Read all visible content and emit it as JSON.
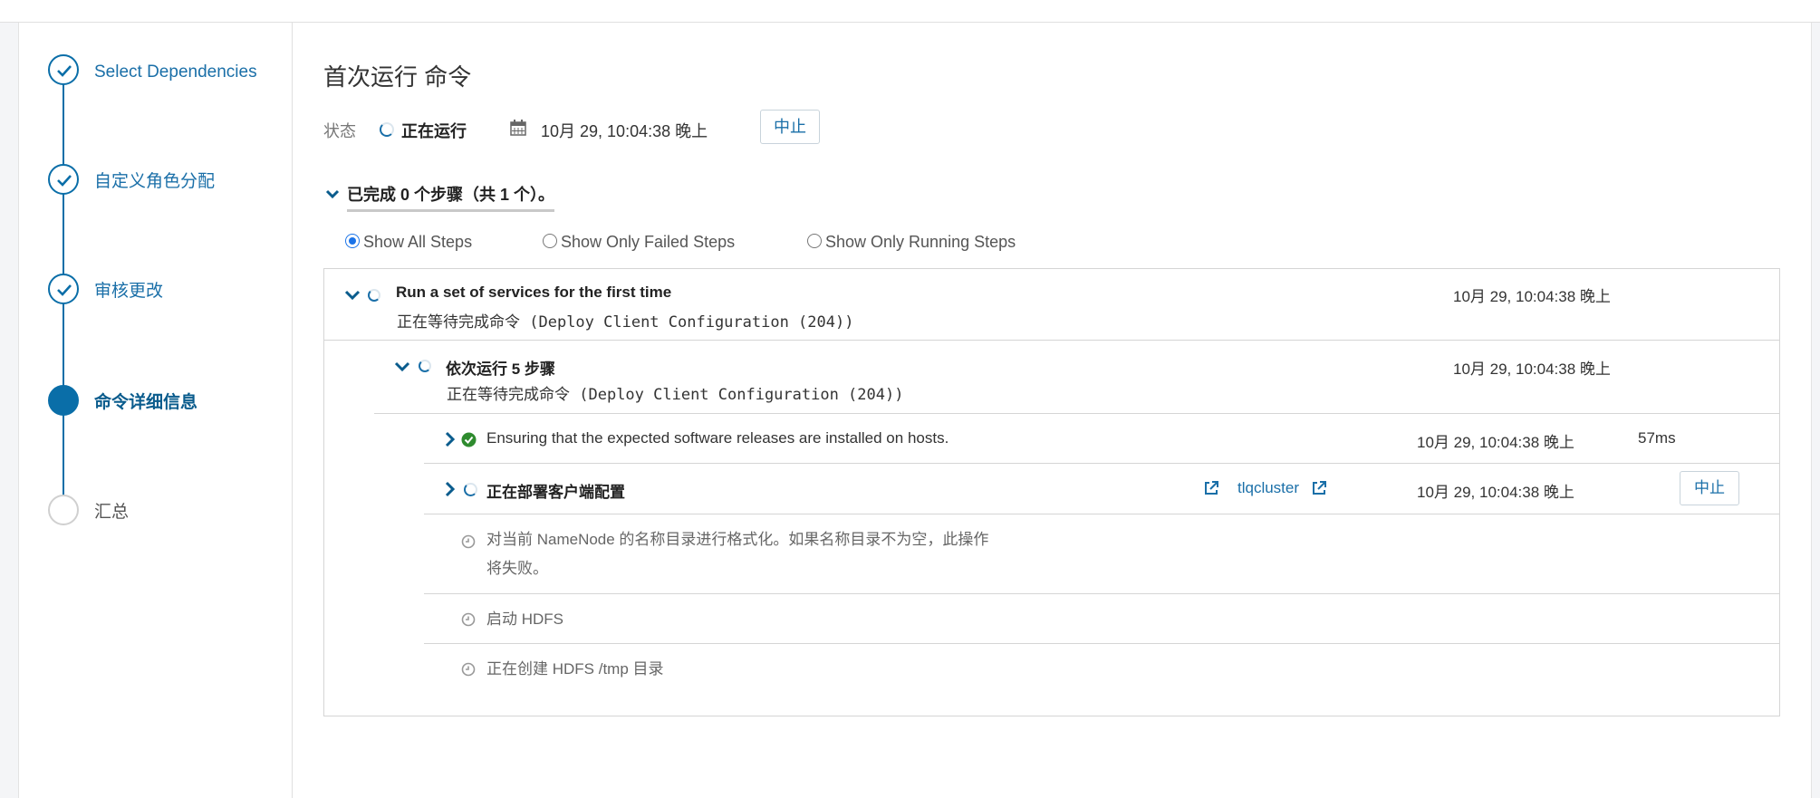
{
  "sidebar": {
    "steps": [
      {
        "label": "Select Dependencies",
        "state": "done"
      },
      {
        "label": "自定义角色分配",
        "state": "done"
      },
      {
        "label": "审核更改",
        "state": "done"
      },
      {
        "label": "命令详细信息",
        "state": "active"
      },
      {
        "label": "汇总",
        "state": "todo"
      }
    ]
  },
  "main": {
    "title": "首次运行 命令",
    "status_label": "状态",
    "status_text": "正在运行",
    "status_time": "10月 29, 10:04:38 晚上",
    "abort_label": "中止",
    "summary": "已完成 0 个步骤（共 1 个）。",
    "filters": [
      "Show All Steps",
      "Show Only Failed Steps",
      "Show Only Running Steps"
    ],
    "selected_filter": "Show All Steps"
  },
  "steps": {
    "root": {
      "title": "Run a set of services for the first time",
      "sub_cn": "正在等待完成命令",
      "sub_cmd": "(Deploy Client Configuration (204))",
      "time": "10月 29, 10:04:38 晚上"
    },
    "seq": {
      "title": "依次运行 5 步骤",
      "sub_cn": "正在等待完成命令",
      "sub_cmd": "(Deploy Client Configuration (204))",
      "time": "10月 29, 10:04:38 晚上"
    },
    "ensure": {
      "title": "Ensuring that the expected software releases are installed on hosts.",
      "time": "10月 29, 10:04:38 晚上",
      "duration": "57ms"
    },
    "deploy": {
      "title": "正在部署客户端配置",
      "cluster": "tlqcluster",
      "time": "10月 29, 10:04:38 晚上",
      "abort_label": "中止"
    },
    "pending": [
      "对当前 NameNode 的名称目录进行格式化。如果名称目录不为空，此操作将失败。",
      "启动 HDFS",
      "正在创建 HDFS /tmp 目录"
    ]
  },
  "colors": {
    "accent": "#0a6ea8",
    "success": "#2e8b2e",
    "link": "#1a6fa8"
  }
}
